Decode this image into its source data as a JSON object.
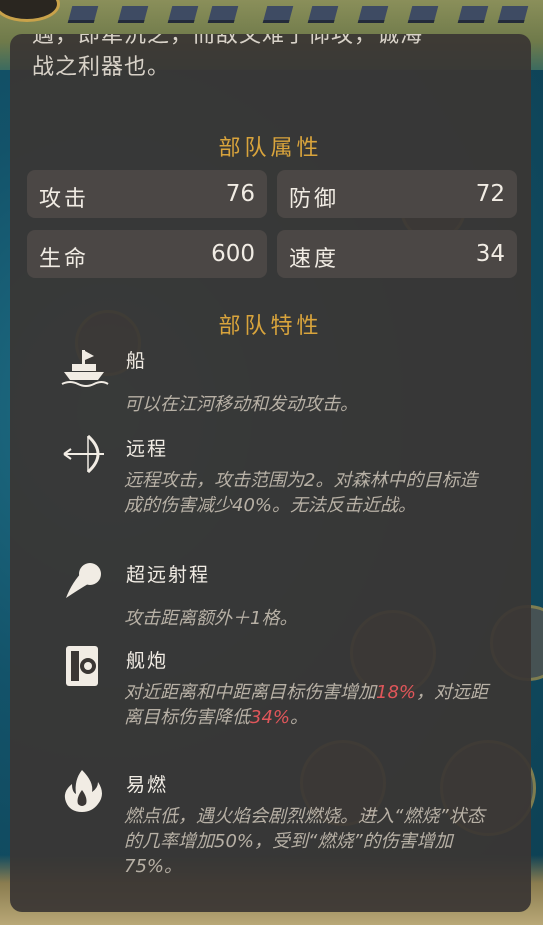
{
  "lore": {
    "line_partial": "",
    "line2": "遇，即犁沉之，而敌又难于仰攻，诚海",
    "line3": "战之利器也。"
  },
  "attributes": {
    "title": "部队属性",
    "stats": [
      {
        "label": "攻击",
        "value": "76"
      },
      {
        "label": "防御",
        "value": "72"
      },
      {
        "label": "生命",
        "value": "600"
      },
      {
        "label": "速度",
        "value": "34"
      }
    ]
  },
  "traits": {
    "title": "部队特性",
    "items": [
      {
        "name": "船",
        "icon": "ship-icon",
        "desc": "可以在江河移动和发动攻击。"
      },
      {
        "name": "远程",
        "icon": "bow-icon",
        "desc": "远程攻击，攻击范围为2。对森林中的目标造成的伤害减少40%。无法反击近战。"
      },
      {
        "name": "超远射程",
        "icon": "projectile-icon",
        "desc": "攻击距离额外＋1格。"
      },
      {
        "name": "舰炮",
        "icon": "cannon-icon",
        "desc_a": "对近距离和中距离目标伤害增加",
        "desc_b": "18%",
        "desc_c": "，对远距离目标伤害降低",
        "desc_d": "34%",
        "desc_e": "。"
      },
      {
        "name": "易燃",
        "icon": "fire-icon",
        "desc": "燃点低，遇火焰会剧烈燃烧。进入“燃烧”状态的几率增加50%，受到“燃烧”的伤害增加75%。"
      }
    ]
  },
  "colors": {
    "panel_bg": "#3a3634",
    "section_title": "#d9a43c",
    "highlight": "#e0565a",
    "stat_bg": "#4b4745"
  }
}
